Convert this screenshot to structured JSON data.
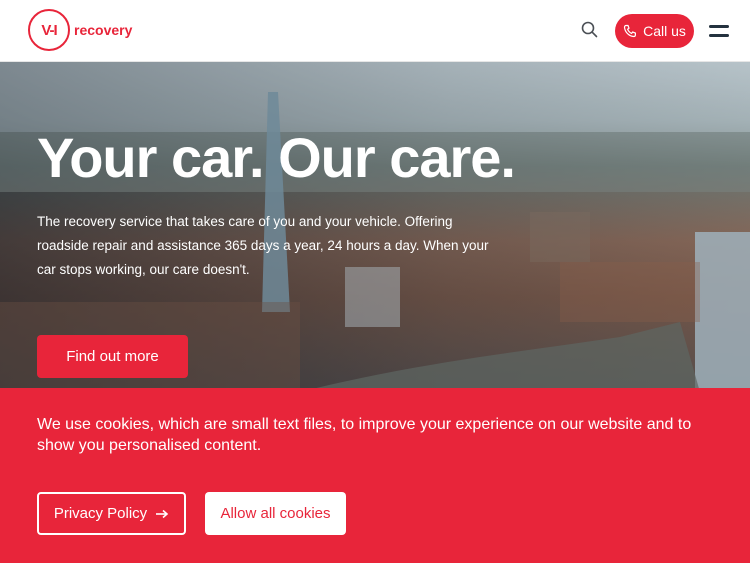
{
  "header": {
    "logo_mark": "V-I",
    "logo_text": "recovery",
    "call_label": "Call us"
  },
  "hero": {
    "title": "Your car. Our care.",
    "text": "The recovery service that takes care of you and your vehicle. Offering roadside repair and assistance 365 days a year, 24 hours a day. When your car stops working, our care doesn't.",
    "cta_label": "Find out more"
  },
  "cookie": {
    "text": "We use cookies, which are small text files, to improve your experience on our website and to show you personalised content.",
    "privacy_label": "Privacy Policy",
    "allow_label": "Allow all cookies"
  },
  "colors": {
    "brand_red": "#e8253a",
    "menu_dark": "#24323f"
  },
  "icons": [
    "search-icon",
    "phone-icon",
    "menu-icon",
    "arrow-right-icon"
  ]
}
